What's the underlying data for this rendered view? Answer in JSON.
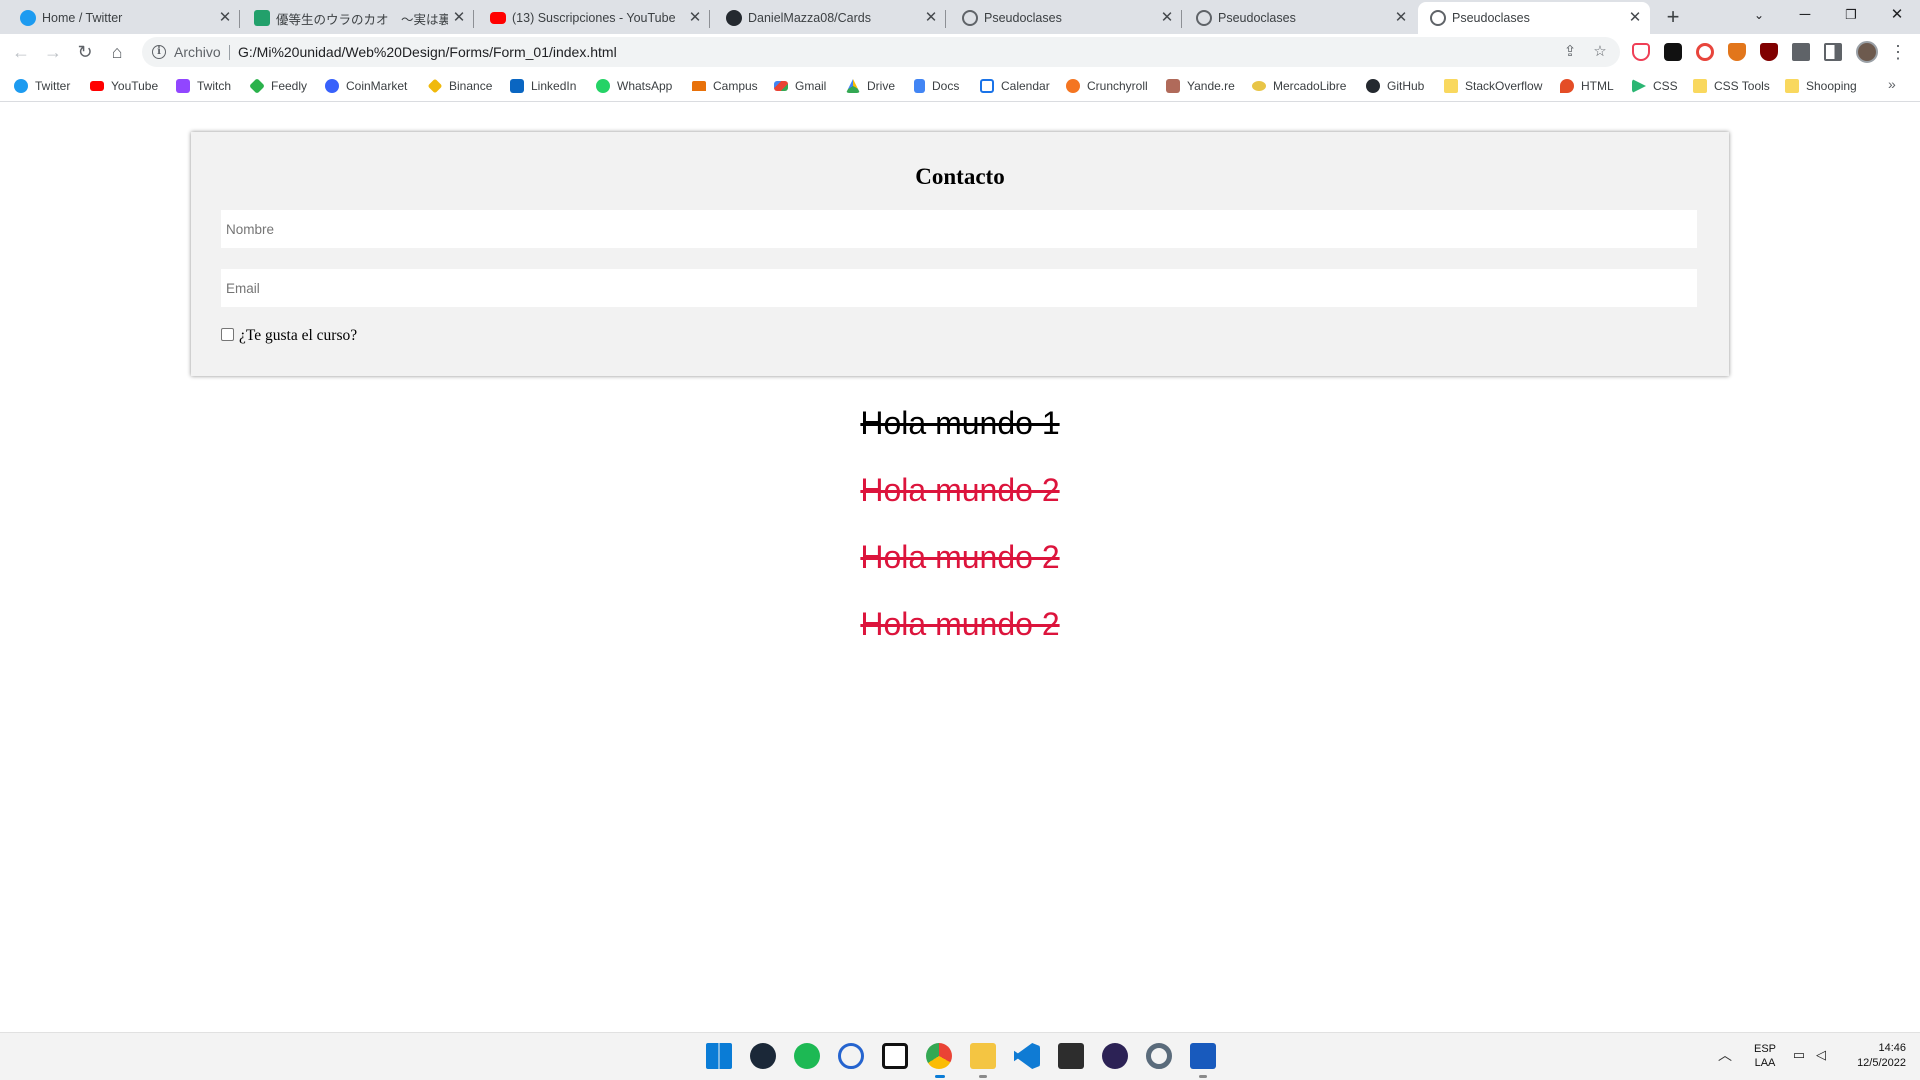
{
  "browser": {
    "tabs": [
      {
        "title": "Home / Twitter",
        "icon": "twitter-icon",
        "color": "#1d9bf0"
      },
      {
        "title": "優等生のウラのカオ　～実は裏アカ",
        "icon": "manga-site-icon",
        "color": "#22a06b"
      },
      {
        "title": "(13) Suscripciones - YouTube",
        "icon": "youtube-icon",
        "color": "#ff0000"
      },
      {
        "title": "DanielMazza08/Cards",
        "icon": "github-icon",
        "color": "#24292f"
      },
      {
        "title": "Pseudoclases",
        "icon": "globe-icon",
        "color": "#5f6368"
      },
      {
        "title": "Pseudoclases",
        "icon": "globe-icon",
        "color": "#5f6368"
      },
      {
        "title": "Pseudoclases",
        "icon": "globe-icon",
        "color": "#5f6368",
        "active": true
      }
    ],
    "address_bar": {
      "scheme_label": "Archivo",
      "url": "G:/Mi%20unidad/Web%20Design/Forms/Form_01/index.html"
    },
    "bookmarks": [
      {
        "label": "Twitter",
        "icon": "twitter-icon",
        "color": "#1d9bf0"
      },
      {
        "label": "YouTube",
        "icon": "youtube-icon",
        "color": "#ff0000"
      },
      {
        "label": "Twitch",
        "icon": "twitch-icon",
        "color": "#9146ff"
      },
      {
        "label": "Feedly",
        "icon": "feedly-icon",
        "color": "#2bb24c"
      },
      {
        "label": "CoinMarket",
        "icon": "coinmarketcap-icon",
        "color": "#3861fb"
      },
      {
        "label": "Binance",
        "icon": "binance-icon",
        "color": "#f0b90b"
      },
      {
        "label": "LinkedIn",
        "icon": "linkedin-icon",
        "color": "#0a66c2"
      },
      {
        "label": "WhatsApp",
        "icon": "whatsapp-icon",
        "color": "#25d366"
      },
      {
        "label": "Campus",
        "icon": "campus-icon",
        "color": "#e8710a"
      },
      {
        "label": "Gmail",
        "icon": "gmail-icon",
        "color": "#ea4335"
      },
      {
        "label": "Drive",
        "icon": "drive-icon",
        "color": "#34a853"
      },
      {
        "label": "Docs",
        "icon": "docs-icon",
        "color": "#4285f4"
      },
      {
        "label": "Calendar",
        "icon": "calendar-icon",
        "color": "#1a73e8"
      },
      {
        "label": "Crunchyroll",
        "icon": "crunchyroll-icon",
        "color": "#f47521"
      },
      {
        "label": "Yande.re",
        "icon": "yandere-icon",
        "color": "#b06a5a"
      },
      {
        "label": "MercadoLibre",
        "icon": "mercadolibre-icon",
        "color": "#e8c547"
      },
      {
        "label": "GitHub",
        "icon": "github-icon",
        "color": "#24292f"
      },
      {
        "label": "StackOverflow",
        "icon": "folder-icon",
        "color": "#f9d85e"
      },
      {
        "label": "HTML",
        "icon": "html-icon",
        "color": "#e44d26"
      },
      {
        "label": "CSS",
        "icon": "css-icon",
        "color": "#2bb673"
      },
      {
        "label": "CSS Tools",
        "icon": "folder-icon",
        "color": "#f9d85e"
      },
      {
        "label": "Shooping",
        "icon": "folder-icon",
        "color": "#f9d85e"
      }
    ]
  },
  "page": {
    "form": {
      "title": "Contacto",
      "name_placeholder": "Nombre",
      "email_placeholder": "Email",
      "checkbox_label": "¿Te gusta el curso?",
      "checkbox_checked": false
    },
    "lines": [
      "Hola mundo 1",
      "Hola mundo 2",
      "Hola mundo 2",
      "Hola mundo 2"
    ],
    "colors": {
      "first_line": "#000000",
      "other_lines": "#dc143c",
      "card_background": "#f2f2f2"
    }
  },
  "taskbar": {
    "apps": [
      "windows-start-icon",
      "steam-icon",
      "spotify-icon",
      "todo-icon",
      "notion-icon",
      "chrome-icon",
      "file-explorer-icon",
      "vscode-icon",
      "terminal-icon",
      "eclipse-icon",
      "settings-icon",
      "word-icon"
    ],
    "language": {
      "line1": "ESP",
      "line2": "LAA"
    },
    "clock": {
      "time": "14:46",
      "date": "12/5/2022"
    }
  }
}
